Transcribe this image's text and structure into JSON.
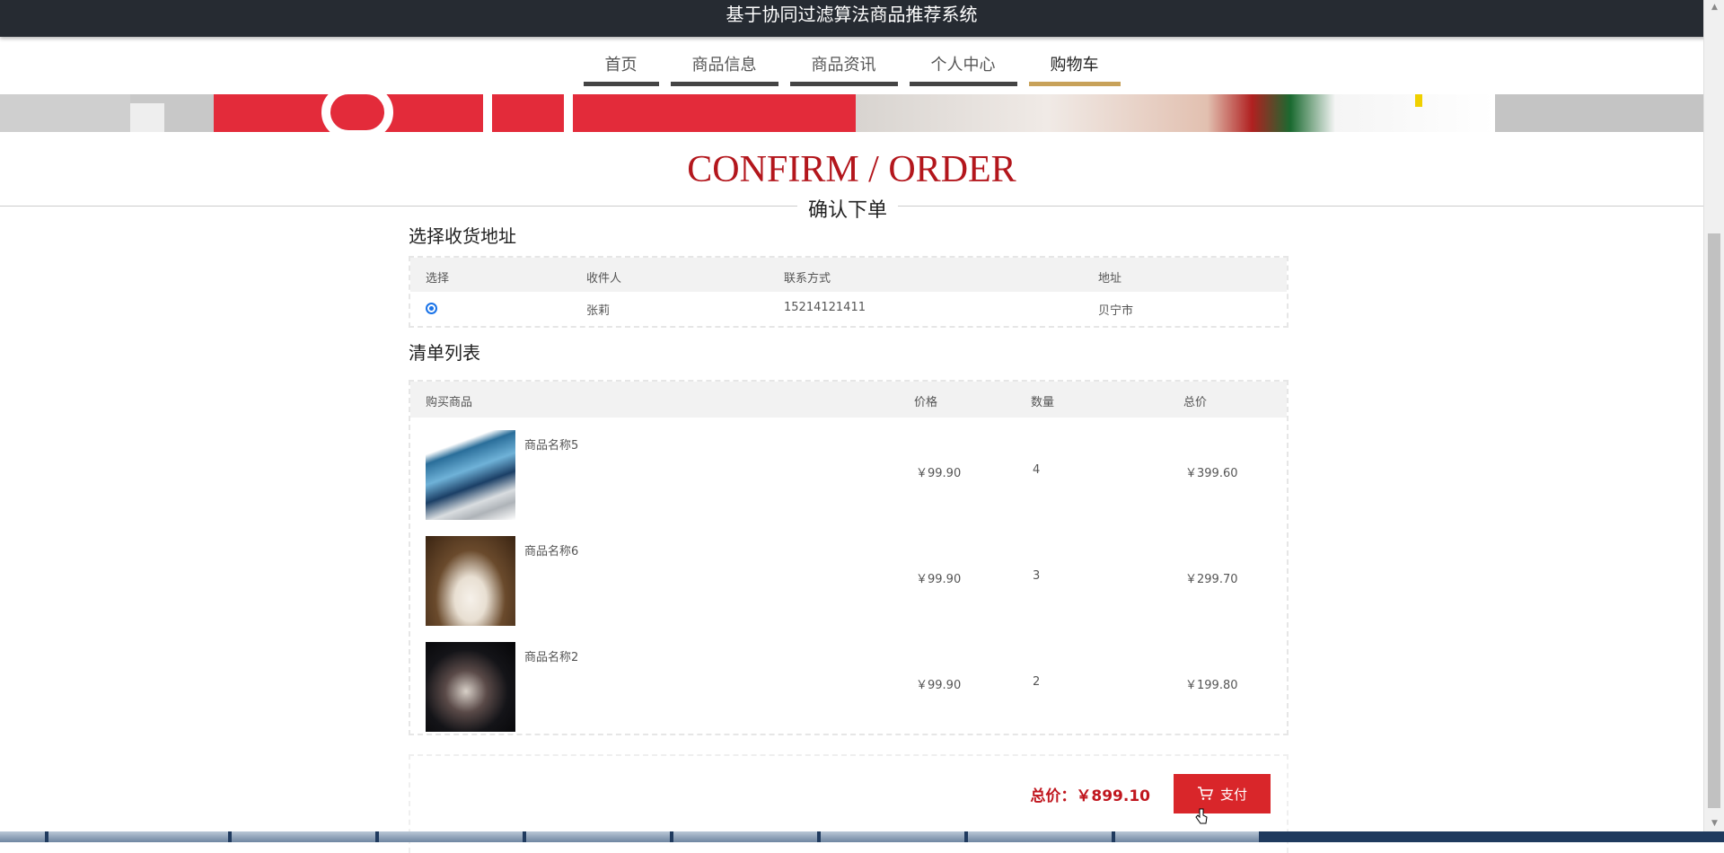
{
  "header": {
    "title": "基于协同过滤算法商品推荐系统"
  },
  "nav": [
    {
      "label": "首页",
      "active": false
    },
    {
      "label": "商品信息",
      "active": false
    },
    {
      "label": "商品资讯",
      "active": false
    },
    {
      "label": "个人中心",
      "active": false
    },
    {
      "label": "购物车",
      "active": true
    }
  ],
  "page": {
    "title_en": "CONFIRM / ORDER",
    "title_cn": "确认下单"
  },
  "address": {
    "section_title": "选择收货地址",
    "columns": [
      "选择",
      "收件人",
      "联系方式",
      "地址"
    ],
    "rows": [
      {
        "selected": true,
        "name": "张莉",
        "phone": "15214121411",
        "address": "贝宁市"
      }
    ]
  },
  "items": {
    "section_title": "清单列表",
    "columns": [
      "购买商品",
      "价格",
      "数量",
      "总价"
    ],
    "rows": [
      {
        "name": "商品名称5",
        "price": "￥99.90",
        "qty": "4",
        "total": "￥399.60",
        "image": "laptop-image"
      },
      {
        "name": "商品名称6",
        "price": "￥99.90",
        "qty": "3",
        "total": "￥299.70",
        "image": "dress-image"
      },
      {
        "name": "商品名称2",
        "price": "￥99.90",
        "qty": "2",
        "total": "￥199.80",
        "image": "screen-image"
      }
    ]
  },
  "summary": {
    "total_label": "总价：￥899.10",
    "pay_label": "支付"
  },
  "colors": {
    "accent": "#b3161c",
    "pay_button": "#d9262a",
    "nav_active": "#c8a25a",
    "topbar": "#262b32"
  }
}
